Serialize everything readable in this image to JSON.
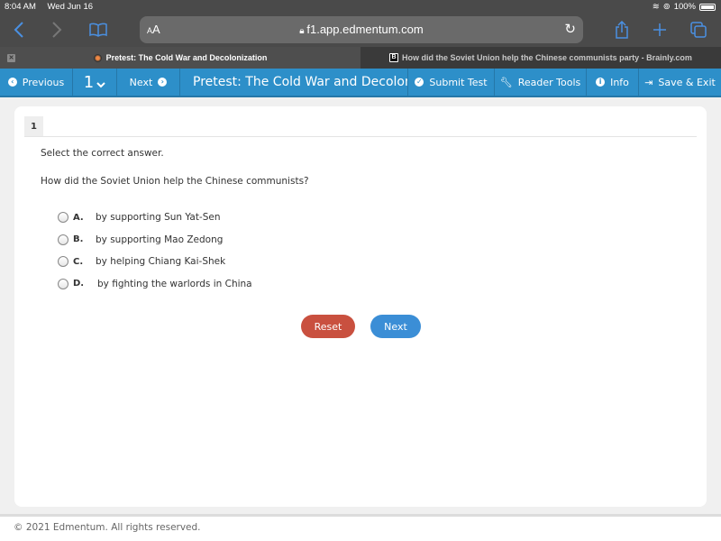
{
  "status_bar": {
    "time": "8:04 AM",
    "date": "Wed Jun 16",
    "battery": "100%"
  },
  "browser": {
    "text_size_label": "AA",
    "url": "f1.app.edmentum.com",
    "icons": {
      "back": "‹",
      "forward": "›",
      "bookmarks": "📖",
      "reload": "↻",
      "share": "⇪",
      "new_tab": "+",
      "tabs": "⧉"
    }
  },
  "tabs": [
    {
      "title": "Pretest: The Cold War and Decolonization",
      "active": true
    },
    {
      "title": "How did the Soviet Union help the Chinese communists party - Brainly.com",
      "active": false
    }
  ],
  "navbar": {
    "previous_label": "Previous",
    "question_number": "1",
    "next_label": "Next",
    "title": "Pretest: The Cold War and Decolonization",
    "submit_label": "Submit Test",
    "reader_tools_label": "Reader Tools",
    "info_label": "Info",
    "save_exit_label": "Save & Exit"
  },
  "question": {
    "number": "1",
    "instruction": "Select the correct answer.",
    "prompt": "How did the Soviet Union help the Chinese communists?",
    "options": [
      {
        "letter": "A.",
        "text": "by supporting Sun Yat-Sen"
      },
      {
        "letter": "B.",
        "text": "by supporting Mao Zedong"
      },
      {
        "letter": "C.",
        "text": "by helping Chiang Kai-Shek"
      },
      {
        "letter": "D.",
        "text": "by fighting the warlords in China"
      }
    ],
    "reset_label": "Reset",
    "next_label": "Next"
  },
  "footer": {
    "copyright": "© 2021 Edmentum. All rights reserved."
  },
  "colors": {
    "navbar": "#2d8fc9",
    "reset_button": "#c9503f",
    "next_button": "#3b8ed6"
  }
}
